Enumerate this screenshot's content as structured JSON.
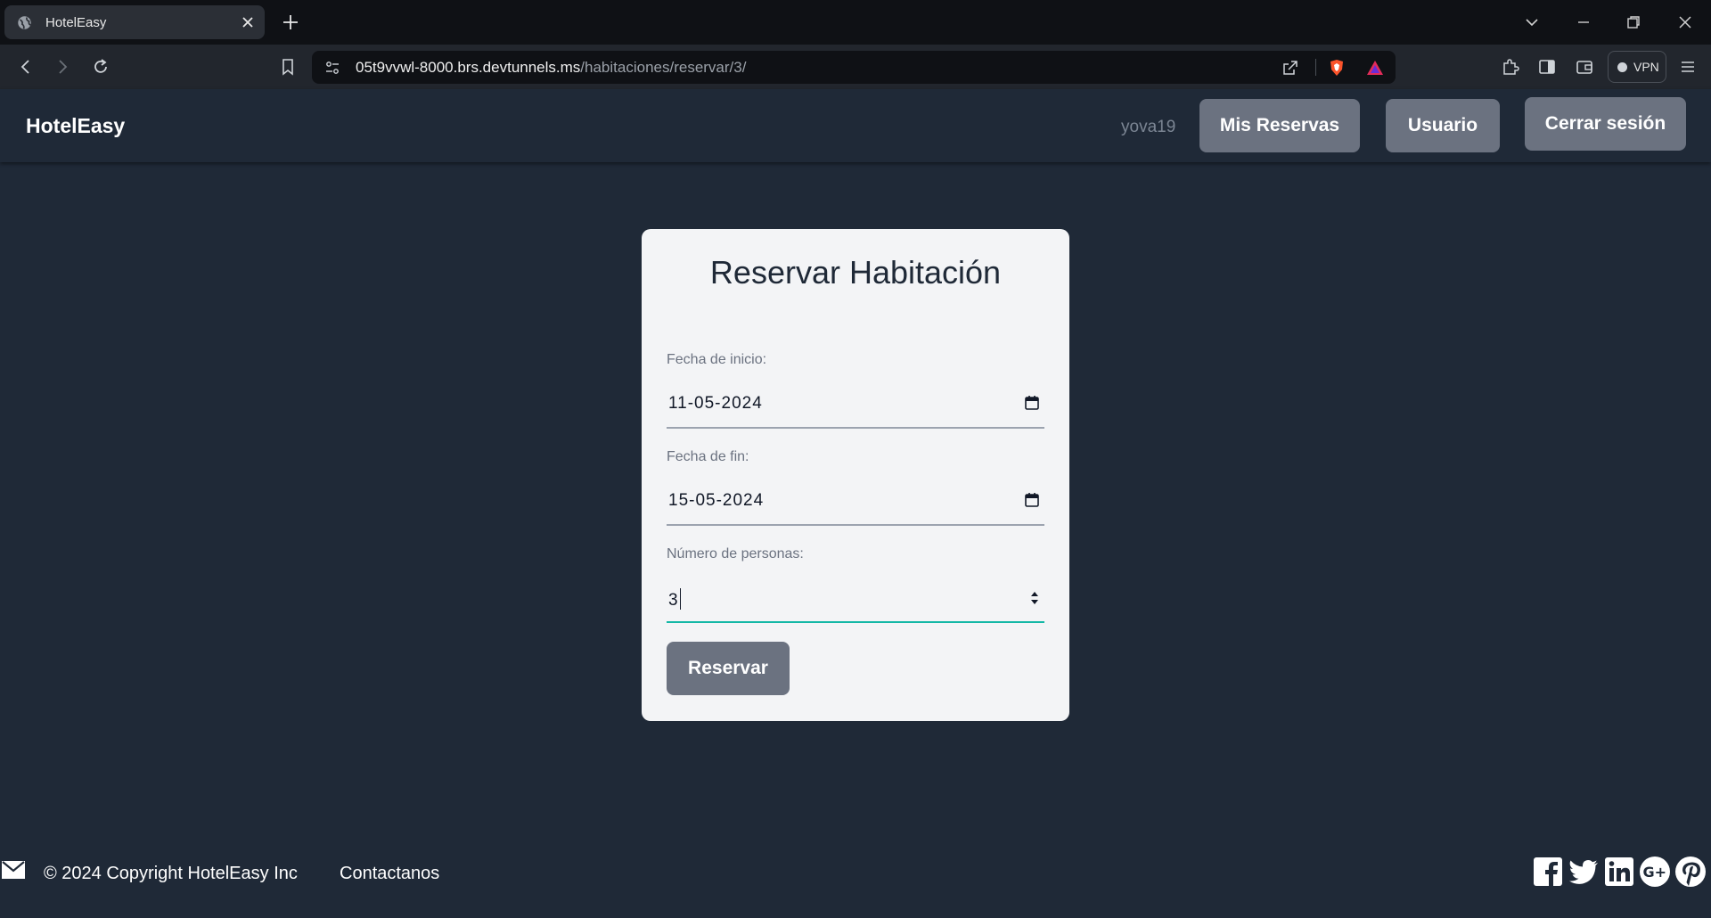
{
  "browser": {
    "tab_title": "HotelEasy",
    "url_host": "05t9vvwl-8000.brs.devtunnels.ms",
    "url_path": "/habitaciones/reservar/3/",
    "vpn_label": "VPN"
  },
  "header": {
    "brand": "HotelEasy",
    "username": "yova19",
    "nav": {
      "reservas": "Mis Reservas",
      "usuario": "Usuario",
      "logout": "Cerrar sesión"
    }
  },
  "form": {
    "title": "Reservar Habitación",
    "start_label": "Fecha de inicio:",
    "start_value": "11-05-2024",
    "end_label": "Fecha de fin:",
    "end_value": "15-05-2024",
    "persons_label": "Número de personas:",
    "persons_value": "3",
    "submit_label": "Reservar"
  },
  "footer": {
    "copyright": "© 2024 Copyright HotelEasy Inc",
    "contact": "Contactanos",
    "social_icons": [
      "facebook-icon",
      "twitter-icon",
      "linkedin-icon",
      "google-plus-icon",
      "pinterest-icon"
    ]
  },
  "colors": {
    "page_bg": "#1f2937",
    "card_bg": "#f3f4f6",
    "button_bg": "#6b7280",
    "focus_underline": "#14b8a6"
  }
}
